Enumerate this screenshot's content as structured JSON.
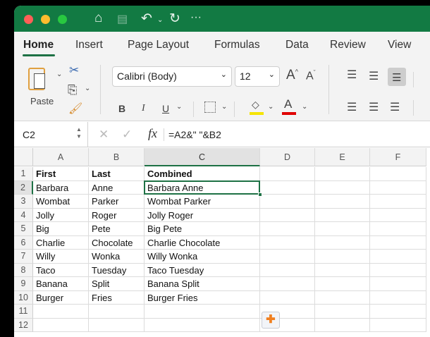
{
  "toolbar_icons": [
    "home-icon",
    "save-icon",
    "undo-icon",
    "redo-icon",
    "more-icon"
  ],
  "tabs": [
    "Home",
    "Insert",
    "Page Layout",
    "Formulas",
    "Data",
    "Review",
    "View"
  ],
  "active_tab": "Home",
  "ribbon": {
    "paste_label": "Paste",
    "font_name": "Calibri (Body)",
    "font_size": "12",
    "bold": "B",
    "italic": "I",
    "underline": "U",
    "font_color_letter": "A",
    "highlight_color": "#f5e400",
    "font_color": "#e00000"
  },
  "formula_bar": {
    "name_box": "C2",
    "fx": "fx",
    "formula": "=A2&\" \"&B2"
  },
  "columns": [
    "A",
    "B",
    "C",
    "D",
    "E",
    "F"
  ],
  "selected_cell": "C2",
  "rows": [
    [
      "First",
      "Last",
      "Combined"
    ],
    [
      "Barbara",
      "Anne",
      "Barbara Anne"
    ],
    [
      "Wombat",
      "Parker",
      "Wombat Parker"
    ],
    [
      "Jolly",
      "Roger",
      "Jolly Roger"
    ],
    [
      "Big",
      "Pete",
      "Big Pete"
    ],
    [
      "Charlie",
      "Chocolate",
      "Charlie Chocolate"
    ],
    [
      "Willy",
      "Wonka",
      "Willy Wonka"
    ],
    [
      "Taco",
      "Tuesday",
      "Taco Tuesday"
    ],
    [
      "Banana",
      "Split",
      "Banana Split"
    ],
    [
      "Burger",
      "Fries",
      "Burger Fries"
    ],
    [
      "",
      "",
      ""
    ],
    [
      "",
      "",
      ""
    ]
  ],
  "accent": "#1e7145"
}
